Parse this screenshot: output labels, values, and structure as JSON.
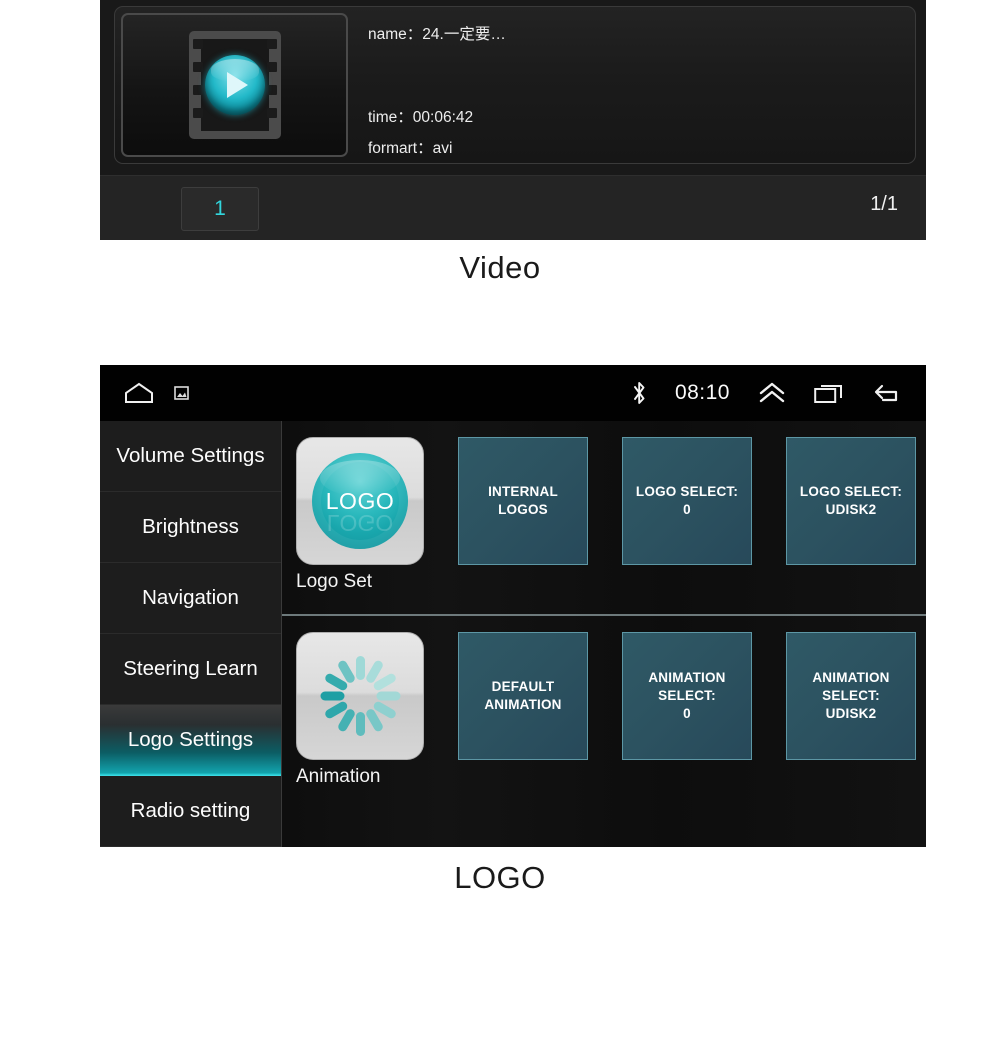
{
  "video_screen": {
    "item": {
      "name_label": "name：",
      "name_value": "24.一定要…",
      "time_label": "time：",
      "time_value": "00:06:42",
      "format_label": "formart：",
      "format_value": "avi",
      "thumb_icon": "video-film-play-icon"
    },
    "pager": {
      "current_page_button": "1",
      "page_count": "1/1"
    }
  },
  "caption_video": "Video",
  "caption_logo": "LOGO",
  "logo_screen": {
    "statusbar": {
      "home_icon": "home-icon",
      "screenshot_icon": "screenshot-icon",
      "bluetooth_icon": "bluetooth-icon",
      "time": "08:10",
      "chevron_up_icon": "chevron-double-up-icon",
      "recents_icon": "recent-apps-icon",
      "back_icon": "back-arrow-icon"
    },
    "sidebar": {
      "items": [
        {
          "label": "Volume Settings",
          "selected": false
        },
        {
          "label": "Brightness",
          "selected": false
        },
        {
          "label": "Navigation",
          "selected": false
        },
        {
          "label": "Steering Learn",
          "selected": false
        },
        {
          "label": "Logo Settings",
          "selected": true
        },
        {
          "label": "Radio setting",
          "selected": false
        }
      ]
    },
    "rows": [
      {
        "app": {
          "label": "Logo Set",
          "icon": "logo-badge-icon",
          "icon_text": "LOGO"
        },
        "tiles": [
          "INTERNAL LOGOS",
          "LOGO SELECT:\n0",
          "LOGO SELECT:\nUDISK2"
        ]
      },
      {
        "app": {
          "label": "Animation",
          "icon": "spinner-icon",
          "icon_text": ""
        },
        "tiles": [
          "DEFAULT\nANIMATION",
          "ANIMATION\nSELECT:\n0",
          "ANIMATION\nSELECT:\nUDISK2"
        ]
      }
    ]
  },
  "colors": {
    "accent_teal": "#2fd6de",
    "tile_fill": "#2c5260",
    "tile_border": "#5d97a5",
    "screen_bg": "#0b0b0b",
    "sidebar_bg": "#1d1d1d"
  }
}
